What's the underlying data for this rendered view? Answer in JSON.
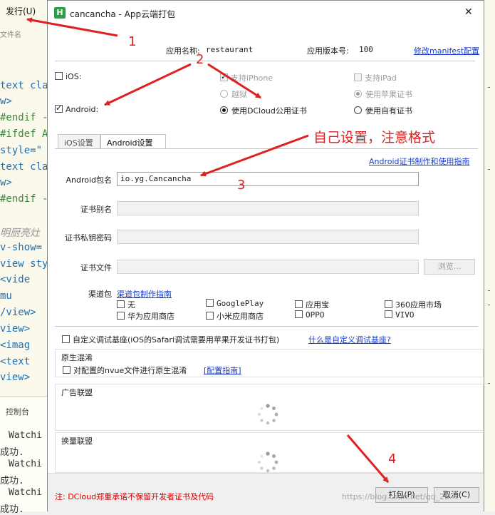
{
  "editor": {
    "menu_publish": "发行(U)",
    "file_name_label": "文件名",
    "code_lines": [
      {
        "text": "text cla",
        "cls": "kw"
      },
      {
        "text": "w>",
        "cls": "kw"
      },
      {
        "text": "#endif -",
        "cls": "cm"
      },
      {
        "text": "#ifdef A",
        "cls": "cm"
      },
      {
        "text": " style=\"",
        "cls": "kw"
      },
      {
        "text": "text cla",
        "cls": "kw"
      },
      {
        "text": "w>",
        "cls": "kw"
      },
      {
        "text": "#endif -",
        "cls": "cm"
      },
      {
        "text": "明厨亮灶",
        "cls": "gr"
      },
      {
        "text": " v-show=",
        "cls": "kw"
      },
      {
        "text": "view sty",
        "cls": "kw"
      },
      {
        "text": "  <vide",
        "cls": "kw"
      },
      {
        "text": "     mu",
        "cls": "kw"
      },
      {
        "text": "/view>",
        "cls": "kw"
      },
      {
        "text": "view>",
        "cls": "kw"
      },
      {
        "text": "  <imag",
        "cls": "kw"
      },
      {
        "text": "  <text",
        "cls": "kw"
      },
      {
        "text": "view>",
        "cls": "kw"
      }
    ],
    "console_title": "控制台",
    "console_lines": [
      "Watchi",
      "成功.",
      "Watchi",
      "成功.",
      "Watchi",
      "成功."
    ]
  },
  "dialog": {
    "title": "cancancha - App云端打包",
    "logo_letter": "H",
    "close": "✕",
    "app_name_label": "应用名称:",
    "app_name_value": "restaurant",
    "app_version_label": "应用版本号:",
    "app_version_value": "100",
    "manifest_link": "修改manifest配置",
    "ios_label": "iOS:",
    "android_label": "Android:",
    "support_iphone": "支持iPhone",
    "support_ipad": "支持iPad",
    "yueyu": "越狱",
    "use_apple_cert": "使用苹果证书",
    "use_dcloud_cert": "使用DCloud公用证书",
    "use_own_cert": "使用自有证书",
    "tabs": [
      "iOS设置",
      "Android设置"
    ],
    "android_cert_link": "Android证书制作和使用指南",
    "package_label": "Android包名",
    "package_value": "io.yg.Cancancha",
    "alias_label": "证书别名",
    "key_password_label": "证书私钥密码",
    "cert_file_label": "证书文件",
    "browse_button": "浏览...",
    "channel_label": "渠道包",
    "channel_link": "渠道包制作指南",
    "channels": [
      "无",
      "GooglePlay",
      "应用宝",
      "360应用市场",
      "华为应用商店",
      "小米应用商店",
      "OPPO",
      "VIVO"
    ],
    "custom_base_label": "自定义调试基座(iOS的Safari调试需要用苹果开发证书打包)",
    "custom_base_link": "什么是自定义调试基座?",
    "native_mix_title": "原生混淆",
    "native_mix_label": "对配置的nvue文件进行原生混淆",
    "native_mix_link": "[配置指南]",
    "ad_title": "广告联盟",
    "exchange_title": "换量联盟",
    "footer_note": "注: DCloud郑重承诺不保留开发者证书及代码",
    "pack_button": "打包(P)",
    "cancel_button": "取消(C)"
  },
  "annotations": {
    "n1": "1",
    "n2": "2",
    "n3": "3",
    "n4": "4",
    "note": "自己设置，注意格式",
    "color": "#e02020"
  },
  "watermark": "https://blog.csdn.net/qq_28..."
}
